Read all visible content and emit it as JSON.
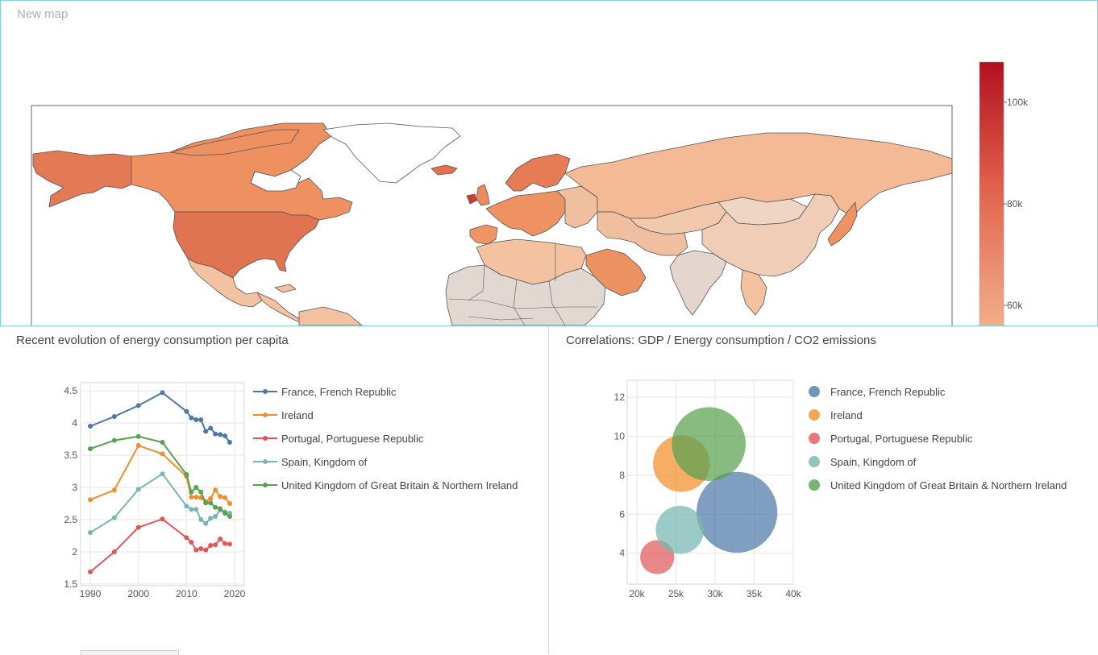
{
  "map": {
    "title": "New map",
    "colorscale": {
      "ticks": [
        "100k",
        "80k",
        "60k"
      ],
      "colors": [
        "#b2101f",
        "#e0604a",
        "#f3b48e"
      ]
    },
    "colors": {
      "canada": "#ee9060",
      "usa": "#e07352",
      "alaska": "#e47a55",
      "greenland": "#ffffff",
      "russia": "#f4b995",
      "china": "#efcdb6",
      "mongolia": "#eed5c4",
      "kazakh": "#f1c9ad",
      "europe": "#ee9262",
      "scandinavia": "#e67c56",
      "uk": "#ec8c5d",
      "ireland": "#cf3c35",
      "iberia": "#ef9563",
      "africa": "#e2d8d2",
      "maghreb": "#f4c2a0",
      "saudi": "#ec9160",
      "india": "#e4d6cf",
      "mexico": "#f3c2a1",
      "japan": "#ee9262",
      "middle_east": "#f0bfa0",
      "iceland": "#e66f4f"
    }
  },
  "line_chart": {
    "title": "Recent evolution of energy consumption per capita"
  },
  "bubble_chart": {
    "title": "Correlations: GDP / Energy consumption / CO2 emissions"
  },
  "chart_data": [
    {
      "type": "line",
      "title": "Recent evolution of energy consumption per capita",
      "xlim": [
        1990,
        2020
      ],
      "ylim": [
        1.5,
        4.5
      ],
      "xticks": [
        "1990",
        "2000",
        "2010",
        "2020"
      ],
      "yticks": [
        "1.5",
        "2",
        "2.5",
        "3",
        "3.5",
        "4",
        "4.5"
      ],
      "grid": true,
      "legend": "right",
      "series": [
        {
          "name": "France, French Republic",
          "color": "#4e79a7",
          "x": [
            1990,
            1995,
            2000,
            2005,
            2010,
            2011,
            2012,
            2013,
            2014,
            2015,
            2016,
            2017,
            2018,
            2019
          ],
          "y": [
            3.95,
            4.1,
            4.27,
            4.47,
            4.18,
            4.08,
            4.05,
            4.05,
            3.87,
            3.92,
            3.83,
            3.82,
            3.8,
            3.7
          ]
        },
        {
          "name": "Ireland",
          "color": "#f28e2b",
          "x": [
            1990,
            1995,
            2000,
            2005,
            2010,
            2011,
            2012,
            2013,
            2014,
            2015,
            2016,
            2017,
            2018,
            2019
          ],
          "y": [
            2.81,
            2.96,
            3.65,
            3.52,
            3.17,
            2.85,
            2.85,
            2.84,
            2.78,
            2.83,
            2.96,
            2.86,
            2.84,
            2.75
          ]
        },
        {
          "name": "Portugal, Portuguese Republic",
          "color": "#e15759",
          "x": [
            1990,
            1995,
            2000,
            2005,
            2010,
            2011,
            2012,
            2013,
            2014,
            2015,
            2016,
            2017,
            2018,
            2019
          ],
          "y": [
            1.69,
            2.0,
            2.38,
            2.51,
            2.22,
            2.15,
            2.03,
            2.05,
            2.03,
            2.1,
            2.11,
            2.2,
            2.13,
            2.12
          ]
        },
        {
          "name": "Spain, Kingdom of",
          "color": "#76b7b2",
          "x": [
            1990,
            1995,
            2000,
            2005,
            2010,
            2011,
            2012,
            2013,
            2014,
            2015,
            2016,
            2017,
            2018,
            2019
          ],
          "y": [
            2.3,
            2.53,
            2.97,
            3.21,
            2.71,
            2.66,
            2.66,
            2.5,
            2.44,
            2.52,
            2.55,
            2.65,
            2.62,
            2.6
          ]
        },
        {
          "name": "United Kingdom of Great Britain & Northern Ireland",
          "color": "#59a14f",
          "x": [
            1990,
            1995,
            2000,
            2005,
            2010,
            2011,
            2012,
            2013,
            2014,
            2015,
            2016,
            2017,
            2018,
            2019
          ],
          "y": [
            3.6,
            3.73,
            3.79,
            3.7,
            3.2,
            2.93,
            3.0,
            2.93,
            2.76,
            2.76,
            2.69,
            2.67,
            2.6,
            2.55
          ]
        }
      ]
    },
    {
      "type": "scatter",
      "title": "Correlations: GDP / Energy consumption / CO2 emissions",
      "xlim": [
        20000,
        40000
      ],
      "ylim": [
        2.5,
        12.5
      ],
      "xticks": [
        "20k",
        "25k",
        "30k",
        "35k",
        "40k"
      ],
      "yticks": [
        "4",
        "6",
        "8",
        "10",
        "12"
      ],
      "grid": true,
      "legend": "right",
      "series": [
        {
          "name": "France, French Republic",
          "color": "#4e79a7",
          "x": 32800,
          "y": 6.1,
          "size": 5.7
        },
        {
          "name": "Ireland",
          "color": "#f28e2b",
          "x": 25700,
          "y": 8.6,
          "size": 4.0
        },
        {
          "name": "Portugal, Portuguese Republic",
          "color": "#e15759",
          "x": 22600,
          "y": 3.8,
          "size": 2.4
        },
        {
          "name": "Spain, Kingdom of",
          "color": "#76b7b2",
          "x": 25500,
          "y": 5.2,
          "size": 3.4
        },
        {
          "name": "United Kingdom of Great Britain & Northern Ireland",
          "color": "#59a14f",
          "x": 29200,
          "y": 9.6,
          "size": 5.2
        }
      ]
    }
  ]
}
